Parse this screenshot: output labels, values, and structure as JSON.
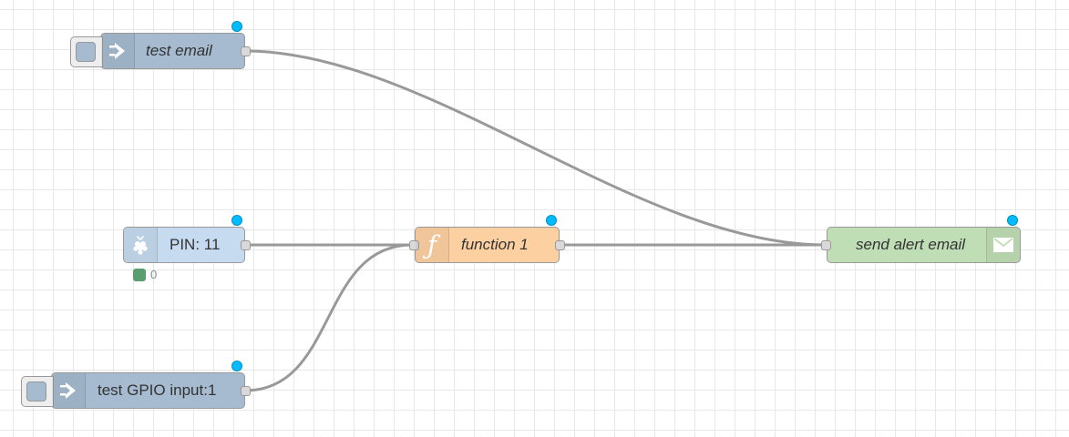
{
  "nodes": {
    "test_email": {
      "label": "test email",
      "color": "#a6bbcf",
      "icon": "inject-arrow-icon"
    },
    "pin": {
      "label": "PIN: 11",
      "color": "#c6dbef",
      "icon": "raspberry-pi-icon",
      "status": "0",
      "status_color": "#5a9e6f"
    },
    "test_gpio": {
      "label": "test GPIO input:1",
      "color": "#a6bbcf",
      "icon": "inject-arrow-icon"
    },
    "function": {
      "label": "function 1",
      "color": "#fdd0a2",
      "icon": "function-icon",
      "icon_glyph": "ƒ"
    },
    "send_email": {
      "label": "send alert email",
      "color": "#c0deb5",
      "icon": "envelope-icon"
    }
  },
  "colors": {
    "wire": "#999999",
    "changed_indicator": "#00bcff",
    "grid": "#e8e8e8"
  }
}
